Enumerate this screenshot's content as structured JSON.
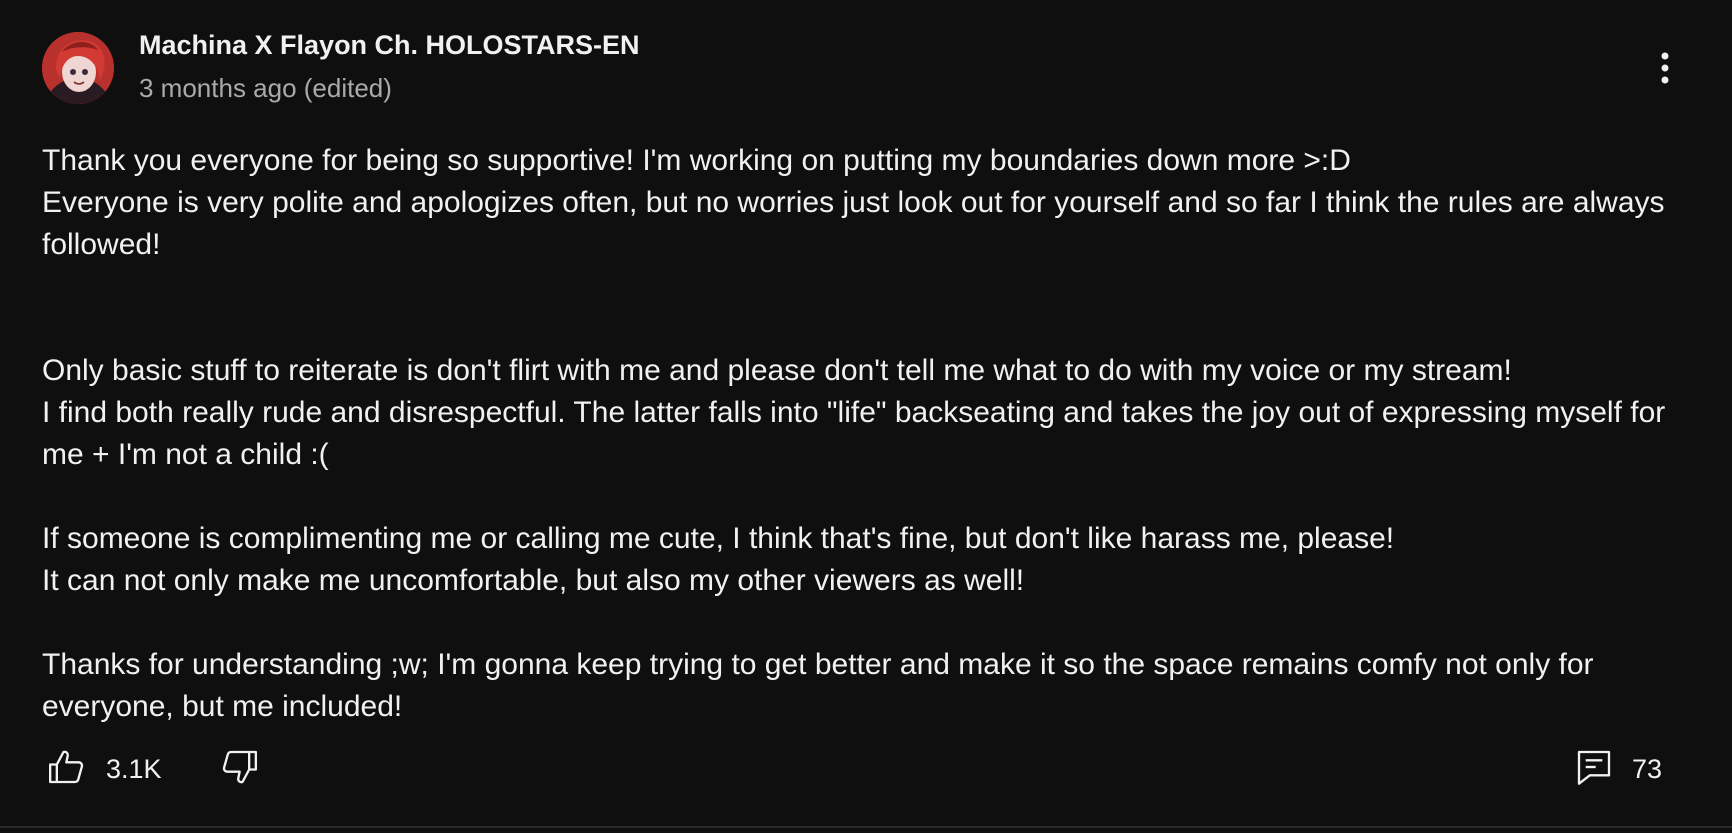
{
  "post": {
    "author": "Machina X Flayon Ch. HOLOSTARS-EN",
    "meta": "3 months ago (edited)",
    "paragraphs": [
      "Thank you everyone for being so supportive! I'm working on putting my boundaries down more >:D\nEveryone is very polite and apologizes often, but no worries just look out for yourself and so far I think the rules are always followed!",
      "Only basic stuff to reiterate is don't flirt with me and please don't tell me what to do with my voice or my stream!\nI find both really rude and disrespectful. The latter falls into \"life\" backseating and takes the joy out of expressing myself for me + I'm not a child :(",
      "If someone is complimenting me or calling me cute, I think that's fine, but don't like harass me, please!\nIt can not only make me uncomfortable, but also my other viewers as well!",
      "Thanks for understanding ;w; I'm gonna keep trying to get better and make it so the space remains comfy not only for everyone, but me included!"
    ]
  },
  "actions": {
    "likes": "3.1K",
    "comments": "73"
  },
  "icons": {
    "avatar": "avatar-image",
    "menu": "more-vert-icon",
    "like": "thumb-up-icon",
    "dislike": "thumb-down-icon",
    "comments": "comment-icon"
  },
  "colors": {
    "background": "#0f0f0f",
    "primary_text": "#f1f1f1",
    "secondary_text": "#aaaaaa",
    "avatar_accent": "#c33a34"
  }
}
